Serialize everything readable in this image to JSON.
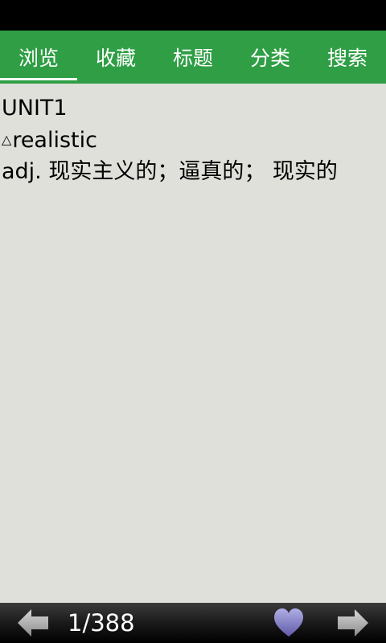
{
  "tabs": [
    {
      "label": "浏览",
      "active": true
    },
    {
      "label": "收藏",
      "active": false
    },
    {
      "label": "标题",
      "active": false
    },
    {
      "label": "分类",
      "active": false
    },
    {
      "label": "搜索",
      "active": false
    }
  ],
  "content": {
    "unit": "UNIT1",
    "bullet": "△",
    "word": "realistic",
    "definition": "adj. 现实主义的；逼真的； 现实的"
  },
  "footer": {
    "page_indicator": "1/388"
  },
  "icons": {
    "prev": "arrow-left-icon",
    "next": "arrow-right-icon",
    "favorite": "heart-icon"
  },
  "colors": {
    "tab_bar": "#2f9e45",
    "content_bg": "#dfe0da",
    "heart": "#8a86c8"
  }
}
